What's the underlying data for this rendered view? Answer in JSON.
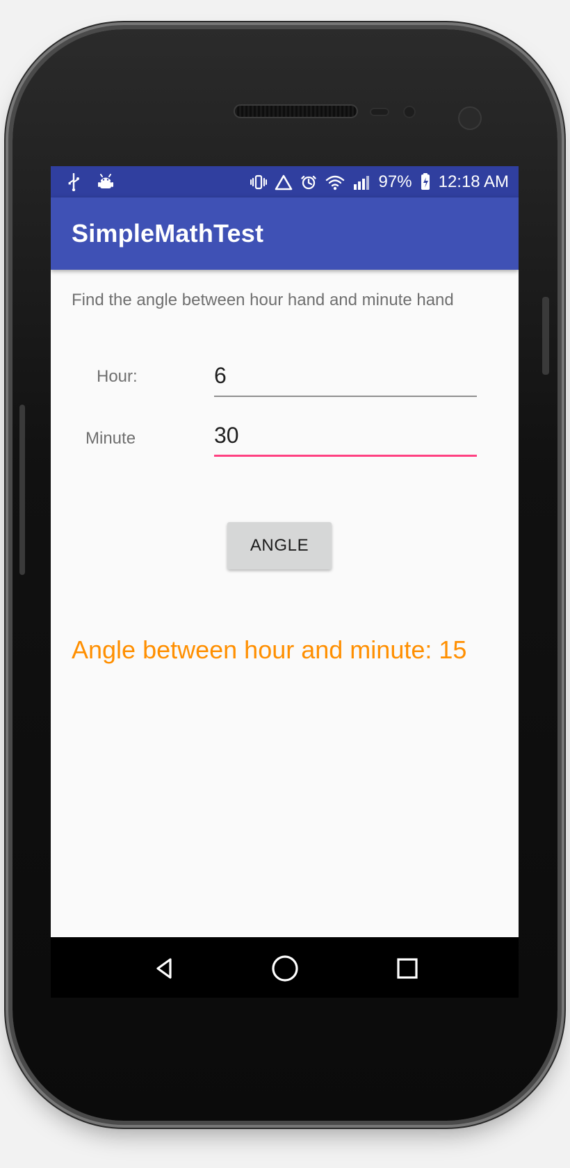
{
  "status_bar": {
    "battery_percent": "97%",
    "time": "12:18 AM",
    "icons": {
      "usb": "usb-icon",
      "android_debug": "android-debug-icon",
      "vibrate": "vibrate-icon",
      "warning": "warning-triangle-icon",
      "alarm": "alarm-clock-icon",
      "wifi": "wifi-icon",
      "signal": "cellular-signal-icon",
      "battery": "battery-charging-icon"
    }
  },
  "app_bar": {
    "title": "SimpleMathTest"
  },
  "content": {
    "prompt": "Find the angle between hour hand and minute hand",
    "hour_label": "Hour:",
    "hour_value": "6",
    "minute_label": "Minute",
    "minute_value": "30",
    "button_label": "ANGLE",
    "result_text": "Angle between hour and minute: 15"
  },
  "navigation": {
    "back_icon": "back-triangle-icon",
    "home_icon": "home-circle-icon",
    "recents_icon": "recents-square-icon"
  },
  "colors": {
    "status_bar": "#303f9f",
    "app_bar": "#3f51b5",
    "accent_underline": "#ff4081",
    "result_text": "#ff8f00",
    "background": "#fafafa"
  }
}
